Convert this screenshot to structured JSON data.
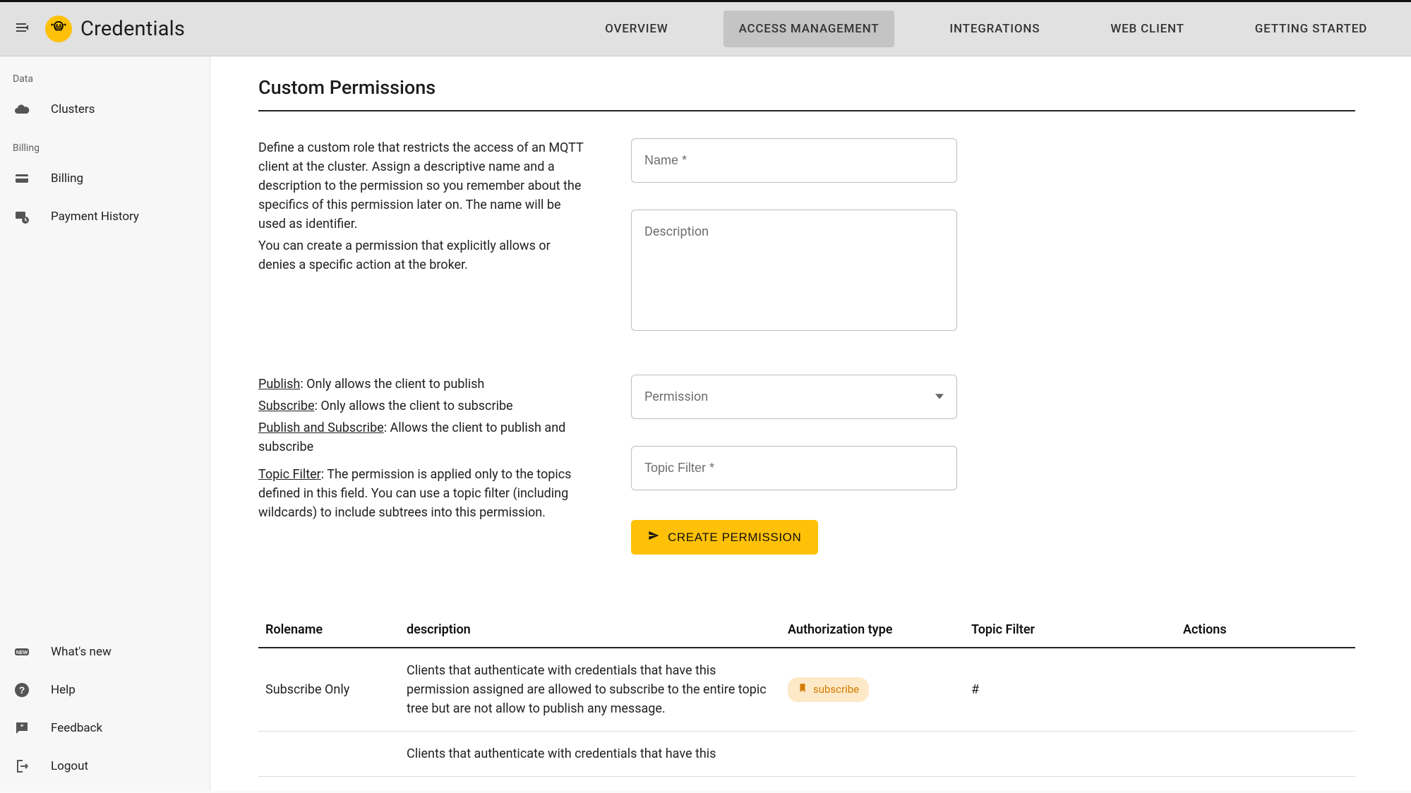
{
  "header": {
    "title": "Credentials",
    "tabs": [
      {
        "label": "OVERVIEW",
        "active": false
      },
      {
        "label": "ACCESS MANAGEMENT",
        "active": true
      },
      {
        "label": "INTEGRATIONS",
        "active": false
      },
      {
        "label": "WEB CLIENT",
        "active": false
      },
      {
        "label": "GETTING STARTED",
        "active": false
      }
    ]
  },
  "sidebar": {
    "sections": [
      {
        "label": "Data",
        "items": [
          {
            "key": "clusters",
            "label": "Clusters"
          }
        ]
      },
      {
        "label": "Billing",
        "items": [
          {
            "key": "billing",
            "label": "Billing"
          },
          {
            "key": "payment-history",
            "label": "Payment History"
          }
        ]
      }
    ],
    "bottom": [
      {
        "key": "whats-new",
        "label": "What's new"
      },
      {
        "key": "help",
        "label": "Help"
      },
      {
        "key": "feedback",
        "label": "Feedback"
      },
      {
        "key": "logout",
        "label": "Logout"
      }
    ]
  },
  "section": {
    "title": "Custom Permissions"
  },
  "intro": {
    "p1": "Define a custom role that restricts the access of an MQTT client at the cluster. Assign a descriptive name and a description to the permission so you remember about the specifics of this permission later on. The name will be used as identifier.",
    "p2": "You can create a permission that explicitly allows or denies a specific action at the broker."
  },
  "fields": {
    "name_placeholder": "Name *",
    "description_placeholder": "Description",
    "permission_label": "Permission",
    "topic_filter_placeholder": "Topic Filter *"
  },
  "explain": {
    "publish_head": "Publish",
    "publish_tail": ": Only allows the client to publish",
    "subscribe_head": "Subscribe",
    "subscribe_tail": ": Only allows the client to subscribe",
    "both_head": "Publish and Subscribe",
    "both_tail": ": Allows the client to publish and subscribe",
    "topic_head": "Topic Filter",
    "topic_tail": ": The permission is applied only to the topics defined in this field. You can use a topic filter (including wildcards) to include subtrees into this permission."
  },
  "create_button": "CREATE PERMISSION",
  "table": {
    "headers": {
      "rolename": "Rolename",
      "description": "description",
      "auth_type": "Authorization type",
      "topic_filter": "Topic Filter",
      "actions": "Actions"
    },
    "rows": [
      {
        "rolename": "Subscribe Only",
        "description": "Clients that authenticate with credentials that have this permission assigned are allowed to subscribe to the entire topic tree but are not allow to publish any message.",
        "auth_type": "subscribe",
        "topic_filter": "#"
      },
      {
        "rolename": "",
        "description": "Clients that authenticate with credentials that have this",
        "auth_type": "",
        "topic_filter": ""
      }
    ]
  }
}
